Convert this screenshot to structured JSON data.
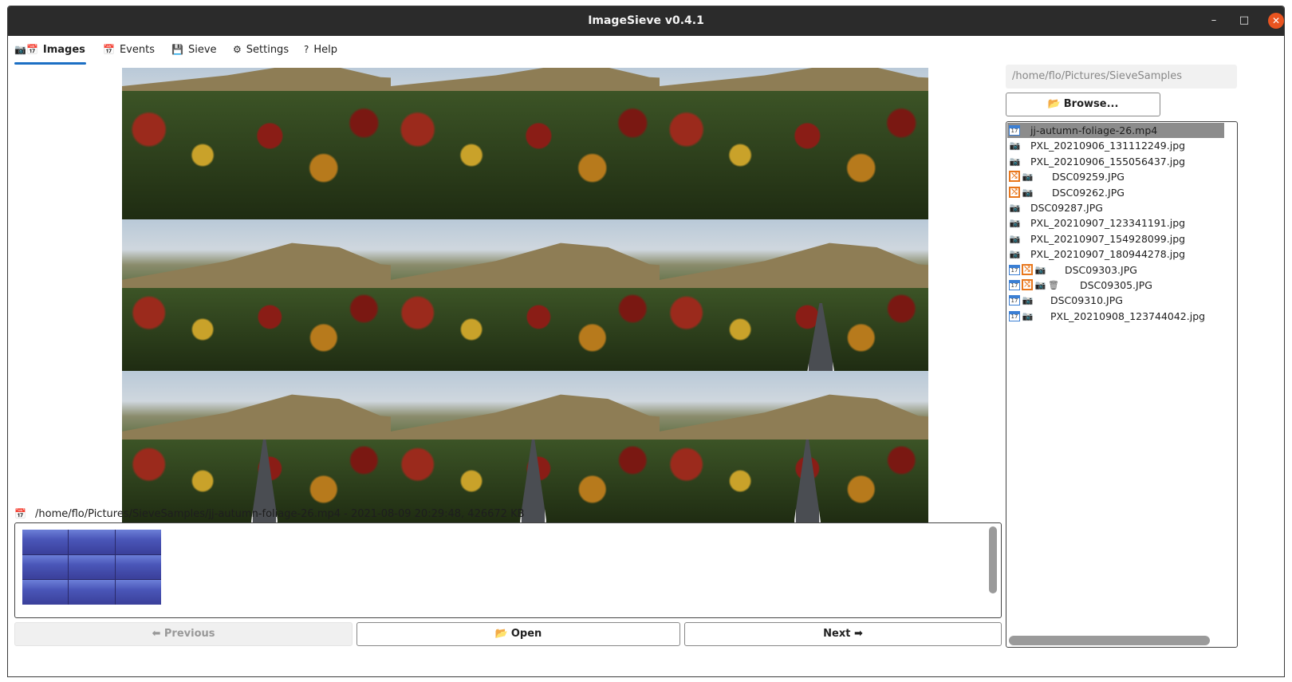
{
  "window": {
    "title": "ImageSieve v0.4.1",
    "minimize": "–",
    "maximize": "□",
    "close": "✕"
  },
  "tabs": [
    {
      "label": "Images",
      "icon": "📷📅",
      "active": true
    },
    {
      "label": "Events",
      "icon": "📅"
    },
    {
      "label": "Sieve",
      "icon": "💾"
    },
    {
      "label": "Settings",
      "icon": "⚙"
    },
    {
      "label": "Help",
      "icon": "?"
    }
  ],
  "file_info": {
    "icon": "calendar-icon",
    "text": "/home/flo/Pictures/SieveSamples/jj-autumn-foliage-26.mp4 - 2021-08-09 20:29:48, 426672 KB"
  },
  "buttons": {
    "previous": "⬅ Previous",
    "open": "Open",
    "next": "Next ➡",
    "browse": "Browse..."
  },
  "folder_path": "/home/flo/Pictures/SieveSamples",
  "files": [
    {
      "name": "jj-autumn-foliage-26.mp4",
      "icons": [
        "calendar"
      ],
      "selected": true
    },
    {
      "name": "PXL_20210906_131112249.jpg",
      "icons": [
        "camera"
      ]
    },
    {
      "name": "PXL_20210906_155056437.jpg",
      "icons": [
        "camera"
      ]
    },
    {
      "name": "DSC09259.JPG",
      "icons": [
        "duplicate",
        "camera"
      ]
    },
    {
      "name": "DSC09262.JPG",
      "icons": [
        "duplicate",
        "camera"
      ]
    },
    {
      "name": "DSC09287.JPG",
      "icons": [
        "camera"
      ]
    },
    {
      "name": "PXL_20210907_123341191.jpg",
      "icons": [
        "camera"
      ]
    },
    {
      "name": "PXL_20210907_154928099.jpg",
      "icons": [
        "camera"
      ]
    },
    {
      "name": "PXL_20210907_180944278.jpg",
      "icons": [
        "camera"
      ]
    },
    {
      "name": "DSC09303.JPG",
      "icons": [
        "calendar",
        "duplicate",
        "camera"
      ]
    },
    {
      "name": "DSC09305.JPG",
      "icons": [
        "calendar",
        "duplicate",
        "camera",
        "trash"
      ]
    },
    {
      "name": "DSC09310.JPG",
      "icons": [
        "calendar",
        "camera"
      ]
    },
    {
      "name": "PXL_20210908_123744042.jpg",
      "icons": [
        "calendar",
        "camera"
      ]
    }
  ],
  "colors": {
    "accent": "#1c6fc4",
    "titlebar": "#2b2b2b",
    "close": "#e95420",
    "duplicate": "#e8771c"
  }
}
